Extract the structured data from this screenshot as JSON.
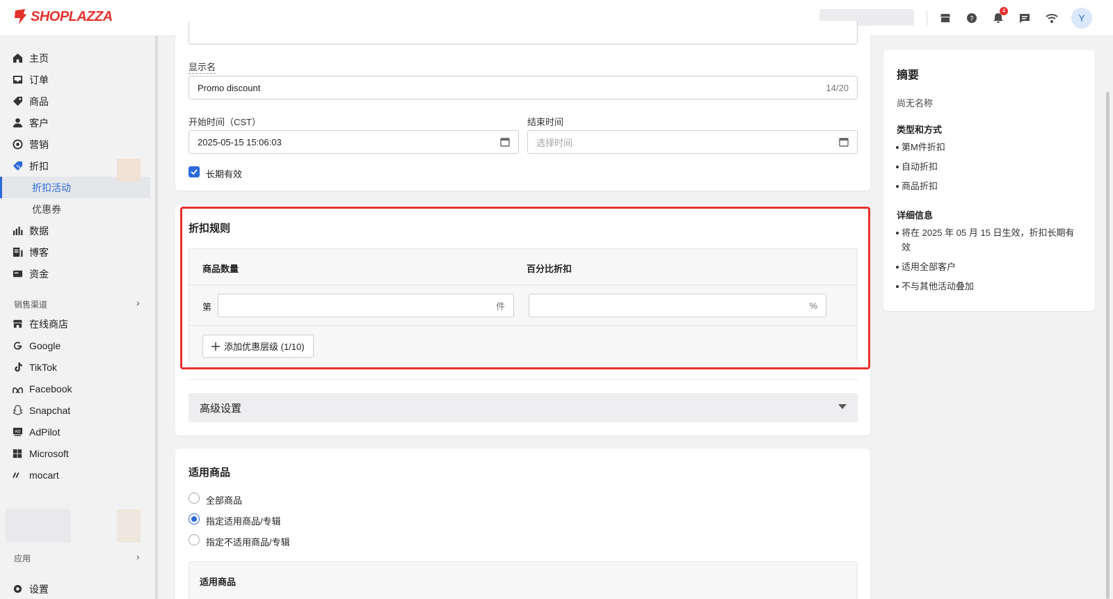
{
  "brand": {
    "name": "SHOPLAZZA",
    "color": "#e5322d"
  },
  "topbar": {
    "icons": [
      "store-icon",
      "help-icon",
      "bell-icon",
      "chat-icon",
      "wifi-icon"
    ],
    "notification_count": "4",
    "avatar_initial": "Y"
  },
  "sidebar": {
    "items": [
      {
        "label": "主页",
        "icon": "home-icon"
      },
      {
        "label": "订单",
        "icon": "inbox-icon"
      },
      {
        "label": "商品",
        "icon": "tag-icon"
      },
      {
        "label": "客户",
        "icon": "person-icon"
      },
      {
        "label": "营销",
        "icon": "target-icon"
      },
      {
        "label": "折扣",
        "icon": "discount-icon"
      },
      {
        "label": "折扣活动",
        "sub": true,
        "active": true
      },
      {
        "label": "优惠券",
        "sub": true
      },
      {
        "label": "数据",
        "icon": "bar-chart-icon"
      },
      {
        "label": "博客",
        "icon": "blog-icon"
      },
      {
        "label": "资金",
        "icon": "wallet-icon"
      }
    ],
    "channels_title": "销售渠道",
    "channels": [
      {
        "label": "在线商店",
        "icon": "store-icon"
      },
      {
        "label": "Google",
        "icon": "google-icon"
      },
      {
        "label": "TikTok",
        "icon": "tiktok-icon"
      },
      {
        "label": "Facebook",
        "icon": "meta-icon"
      },
      {
        "label": "Snapchat",
        "icon": "snapchat-icon"
      },
      {
        "label": "AdPilot",
        "icon": "adpilot-icon"
      },
      {
        "label": "Microsoft",
        "icon": "microsoft-icon"
      },
      {
        "label": "mocart",
        "icon": "mocart-icon"
      }
    ],
    "apps_title": "应用",
    "settings_label": "设置"
  },
  "form": {
    "display_name_label": "显示名",
    "display_name_value": "Promo discount",
    "display_name_counter": "14/20",
    "start_label": "开始时间（CST）",
    "start_value": "2025-05-15 15:06:03",
    "end_label": "结束时间",
    "end_placeholder": "选择时间",
    "long_term_label": "长期有效",
    "long_term_checked": true
  },
  "rules": {
    "title": "折扣规则",
    "col_quantity": "商品数量",
    "col_percent": "百分比折扣",
    "row_prefix": "第",
    "qty_suffix": "件",
    "pct_suffix": "%",
    "add_tier_label": "添加优惠层级 (1/10)"
  },
  "advanced": {
    "label": "高级设置"
  },
  "applicable": {
    "title": "适用商品",
    "options": [
      "全部商品",
      "指定适用商品/专辑",
      "指定不适用商品/专辑"
    ],
    "selected_index": 1,
    "sub_title": "适用商品"
  },
  "summary": {
    "title": "摘要",
    "no_name": "尚无名称",
    "type_title": "类型和方式",
    "types": [
      "第M件折扣",
      "自动折扣",
      "商品折扣"
    ],
    "details_title": "详细信息",
    "details": [
      "将在 2025 年 05 月 15 日生效，折扣长期有效",
      "适用全部客户",
      "不与其他活动叠加"
    ]
  },
  "colors": {
    "accent": "#2c6ad9",
    "highlight": "#e5322d"
  }
}
